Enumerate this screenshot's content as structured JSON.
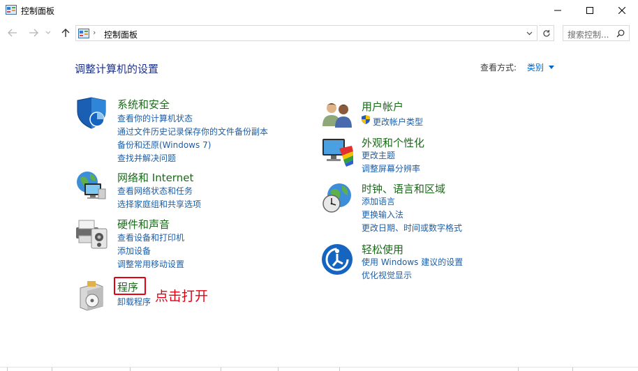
{
  "window": {
    "title": "控制面板"
  },
  "address": {
    "separator": "›",
    "path": "控制面板"
  },
  "search": {
    "placeholder": "搜索控制..."
  },
  "header": {
    "title": "调整计算机的设置",
    "view_by_label": "查看方式:",
    "view_by_value": "类别"
  },
  "categories": {
    "system_security": {
      "title": "系统和安全",
      "links": [
        "查看你的计算机状态",
        "通过文件历史记录保存你的文件备份副本",
        "备份和还原(Windows 7)",
        "查找并解决问题"
      ]
    },
    "network": {
      "title": "网络和 Internet",
      "links": [
        "查看网络状态和任务",
        "选择家庭组和共享选项"
      ]
    },
    "hardware": {
      "title": "硬件和声音",
      "links": [
        "查看设备和打印机",
        "添加设备",
        "调整常用移动设置"
      ]
    },
    "programs": {
      "title": "程序",
      "links": [
        "卸载程序"
      ]
    },
    "user_accounts": {
      "title": "用户帐户",
      "links": [
        "更改帐户类型"
      ]
    },
    "appearance": {
      "title": "外观和个性化",
      "links": [
        "更改主题",
        "调整屏幕分辨率"
      ]
    },
    "clock_region": {
      "title": "时钟、语言和区域",
      "links": [
        "添加语言",
        "更换输入法",
        "更改日期、时间或数字格式"
      ]
    },
    "ease_of_access": {
      "title": "轻松使用",
      "links": [
        "使用 Windows 建议的设置",
        "优化视觉显示"
      ]
    }
  },
  "annotation": {
    "text": "点击打开"
  },
  "colors": {
    "category_title": "#1a6a1a",
    "link": "#1c5ea8",
    "header_title": "#1e3287",
    "annotation_red": "#e60012"
  }
}
